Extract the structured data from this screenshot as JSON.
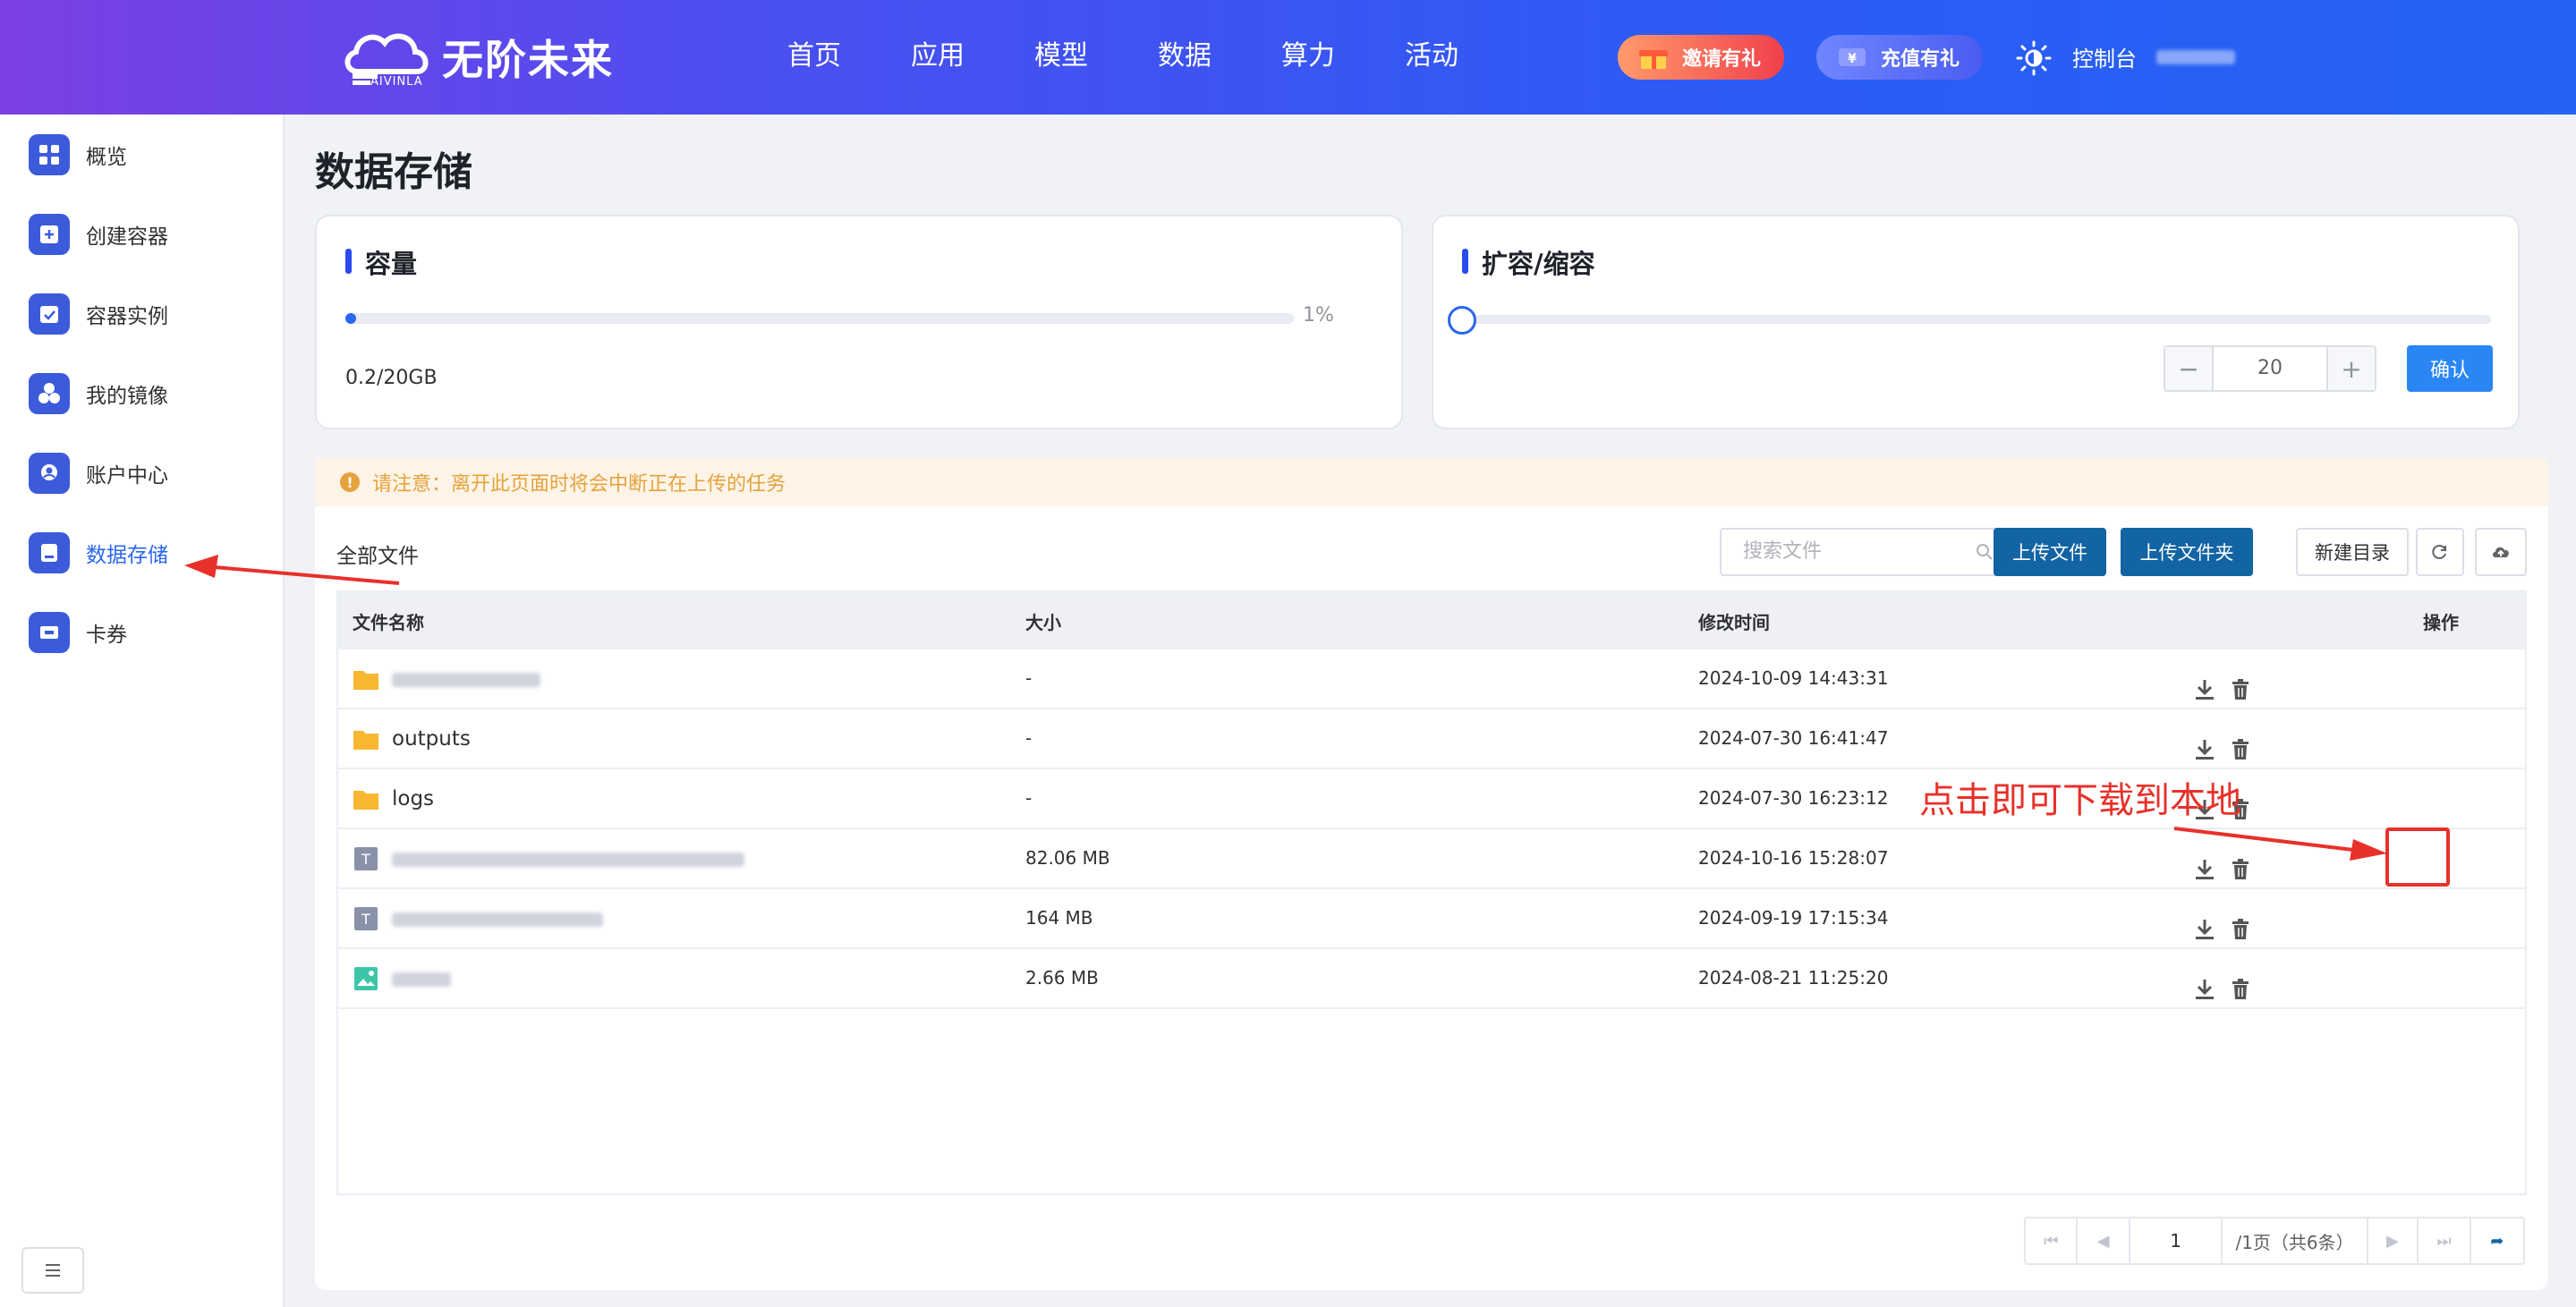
{
  "header": {
    "brand": "无阶未来",
    "brand_sub": "AIVINLA",
    "nav": [
      "首页",
      "应用",
      "模型",
      "数据",
      "算力",
      "活动"
    ],
    "invite_label": "邀请有礼",
    "recharge_label": "充值有礼",
    "console_label": "控制台"
  },
  "sidebar": {
    "items": [
      {
        "label": "概览",
        "icon": "grid-icon"
      },
      {
        "label": "创建容器",
        "icon": "plus-box-icon"
      },
      {
        "label": "容器实例",
        "icon": "checkbox-icon"
      },
      {
        "label": "我的镜像",
        "icon": "hexagons-icon"
      },
      {
        "label": "账户中心",
        "icon": "user-badge-icon"
      },
      {
        "label": "数据存储",
        "icon": "storage-icon"
      },
      {
        "label": "卡券",
        "icon": "ticket-icon"
      }
    ],
    "active_index": 5
  },
  "page": {
    "title": "数据存储"
  },
  "capacity": {
    "title": "容量",
    "percent_label": "1%",
    "percent": 1,
    "used_label": "0.2/20GB"
  },
  "expand": {
    "title": "扩容/缩容",
    "value": "20",
    "confirm_label": "确认"
  },
  "notice": {
    "text": "请注意：离开此页面时将会中断正在上传的任务"
  },
  "files": {
    "breadcrumb": "全部文件",
    "search_placeholder": "搜索文件",
    "upload_file_label": "上传文件",
    "upload_folder_label": "上传文件夹",
    "new_dir_label": "新建目录",
    "columns": [
      "文件名称",
      "大小",
      "修改时间",
      "操作"
    ],
    "rows": [
      {
        "type": "folder",
        "name": "",
        "size": "-",
        "modified": "2024-10-09 14:43:31"
      },
      {
        "type": "folder",
        "name": "outputs",
        "size": "-",
        "modified": "2024-07-30 16:41:47"
      },
      {
        "type": "folder",
        "name": "logs",
        "size": "-",
        "modified": "2024-07-30 16:23:12"
      },
      {
        "type": "text",
        "name": "",
        "size": "82.06 MB",
        "modified": "2024-10-16 15:28:07"
      },
      {
        "type": "text",
        "name": "",
        "size": "164 MB",
        "modified": "2024-09-19 17:15:34"
      },
      {
        "type": "image",
        "name": "",
        "size": "2.66 MB",
        "modified": "2024-08-21 11:25:20"
      }
    ]
  },
  "pagination": {
    "page": "1",
    "info": "/1页（共6条）"
  },
  "annotation": {
    "text": "点击即可下载到本地"
  },
  "colors": {
    "accent": "#2a66f0",
    "primary_button": "#1264a3",
    "annotation_red": "#e8312a",
    "warning": "#e6a23c"
  }
}
